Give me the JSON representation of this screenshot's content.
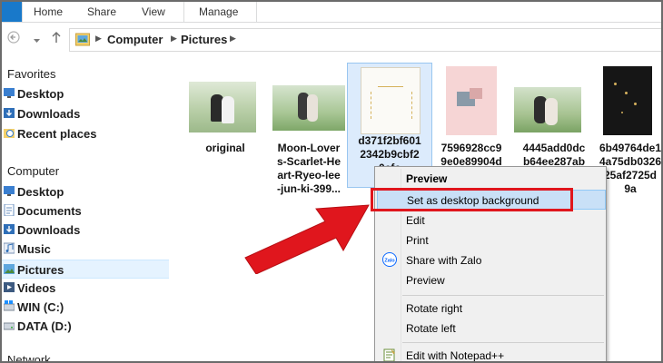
{
  "ribbon": {
    "tabs": [
      "Home",
      "Share",
      "View",
      "Manage"
    ]
  },
  "address": {
    "crumbs": [
      "Computer",
      "Pictures"
    ]
  },
  "nav": {
    "favorites_header": "Favorites",
    "favorites": [
      "Desktop",
      "Downloads",
      "Recent places"
    ],
    "computer_header": "Computer",
    "computer_items": [
      "Desktop",
      "Documents",
      "Downloads",
      "Music",
      "Pictures",
      "Videos",
      "WIN (C:)",
      "DATA (D:)"
    ],
    "network_header": "Network",
    "selected": "Pictures"
  },
  "files": [
    {
      "name_lines": [
        "original"
      ]
    },
    {
      "name_lines": [
        "Moon-Lover",
        "s-Scarlet-He",
        "art-Ryeo-lee",
        "-jun-ki-399..."
      ]
    },
    {
      "name_lines": [
        "d371f2bf601",
        "2342b9cbf2",
        "0cfc"
      ]
    },
    {
      "name_lines": [
        "7596928cc9",
        "9e0e89904d"
      ]
    },
    {
      "name_lines": [
        "4445add0dc",
        "b64ee287ab"
      ]
    },
    {
      "name_lines": [
        "6b49764de1",
        "4a75db0326",
        "25af2725d",
        "9a"
      ]
    }
  ],
  "context_menu": {
    "items": [
      {
        "label": "Preview",
        "default": true
      },
      {
        "label": "Set as desktop background",
        "hover": true
      },
      {
        "label": "Edit"
      },
      {
        "label": "Print"
      },
      {
        "label": "Share with Zalo",
        "icon": "zalo-icon"
      },
      {
        "label": "Preview"
      },
      {
        "label": "Rotate right"
      },
      {
        "label": "Rotate left"
      },
      {
        "label": "Edit with Notepad++",
        "icon": "notepad-plus-icon"
      }
    ],
    "zalo_text": "Zalo"
  },
  "colors": {
    "highlight": "#e0161d",
    "selection": "#dcebfc",
    "menu_hover": "#c9e0f7"
  }
}
